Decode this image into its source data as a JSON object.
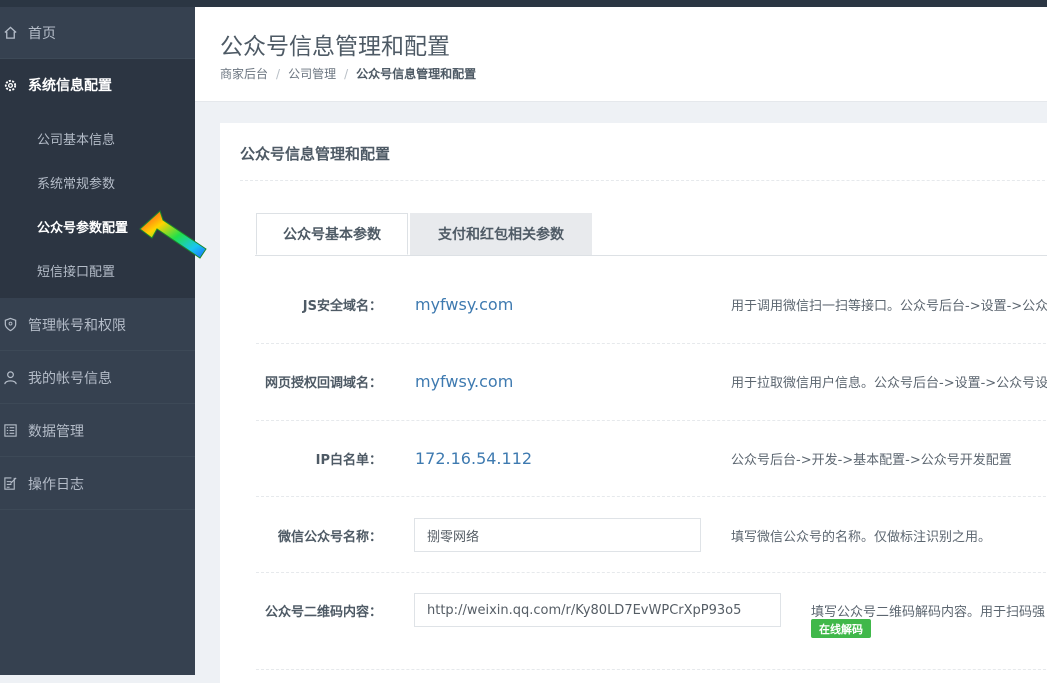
{
  "sidebar": {
    "items": [
      {
        "label": "首页",
        "icon": "home-icon"
      },
      {
        "label": "系统信息配置",
        "icon": "gear-icon"
      },
      {
        "label": "管理帐号和权限",
        "icon": "shield-icon"
      },
      {
        "label": "我的帐号信息",
        "icon": "user-icon"
      },
      {
        "label": "数据管理",
        "icon": "list-icon"
      },
      {
        "label": "操作日志",
        "icon": "edit-icon"
      }
    ],
    "subitems": [
      "公司基本信息",
      "系统常规参数",
      "公众号参数配置",
      "短信接口配置"
    ]
  },
  "header": {
    "title": "公众号信息管理和配置",
    "breadcrumb": [
      "商家后台",
      "公司管理",
      "公众号信息管理和配置"
    ],
    "separator": "/"
  },
  "card": {
    "title": "公众号信息管理和配置",
    "tabs": [
      "公众号基本参数",
      "支付和红包相关参数"
    ]
  },
  "form": {
    "rows": [
      {
        "label": "JS安全域名：",
        "value": "myfwsy.com",
        "help": "用于调用微信扫一扫等接口。公众号后台->设置->公众"
      },
      {
        "label": "网页授权回调域名：",
        "value": "myfwsy.com",
        "help": "用于拉取微信用户信息。公众号后台->设置->公众号设"
      },
      {
        "label": "IP白名单：",
        "value": "172.16.54.112",
        "help": "公众号后台->开发->基本配置->公众号开发配置"
      },
      {
        "label": "微信公众号名称：",
        "value": "捌零网络",
        "help": "填写微信公众号的名称。仅做标注识别之用。"
      },
      {
        "label": "公众号二维码内容：",
        "value": "http://weixin.qq.com/r/Ky80LD7EvWPCrXpP93o5",
        "help": "填写公众号二维码解码内容。用于扫码强",
        "badge": "在线解码"
      }
    ]
  },
  "colors": {
    "sidebar_bg": "#364150",
    "accent": "#3e7ab0",
    "badge": "#40b84a"
  }
}
